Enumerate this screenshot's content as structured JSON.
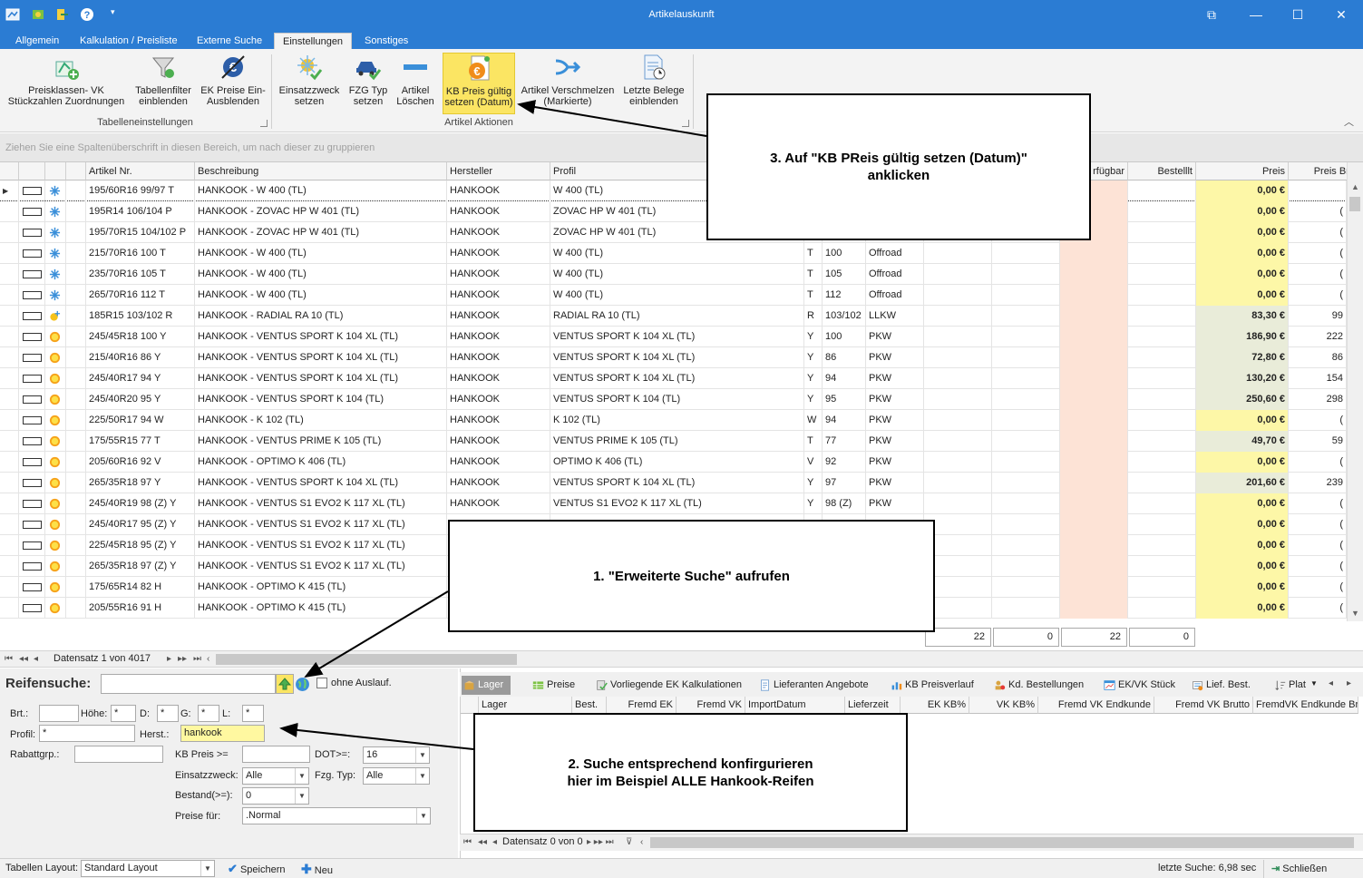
{
  "window": {
    "title": "Artikelauskunft"
  },
  "ribbon_tabs": [
    "Allgemein",
    "Kalkulation / Preisliste",
    "Externe Suche",
    "Einstellungen",
    "Sonstiges"
  ],
  "ribbon": {
    "buttons": [
      {
        "label": "Preisklassen- VK\nStückzahlen Zuordnungen",
        "icon": "price-class-icon"
      },
      {
        "label": "Tabellenfilter\neinblenden",
        "icon": "funnel-icon"
      },
      {
        "label": "EK Preise Ein-\nAusblenden",
        "icon": "euro-icon"
      },
      {
        "label": "Einsatzzweck\nsetzen",
        "icon": "purpose-icon"
      },
      {
        "label": "FZG Typ\nsetzen",
        "icon": "vehicle-icon"
      },
      {
        "label": "Artikel\nLöschen",
        "icon": "delete-icon"
      },
      {
        "label": "KB Preis gültig\nsetzen (Datum)",
        "icon": "euro-document-icon"
      },
      {
        "label": "Artikel Verschmelzen\n(Markierte)",
        "icon": "merge-icon"
      },
      {
        "label": "Letzte Belege\neinblenden",
        "icon": "document-clock-icon"
      }
    ],
    "groups": [
      "Tabelleneinstellungen",
      "Artikel Aktionen"
    ]
  },
  "group_bar": {
    "text": "Ziehen Sie eine Spaltenüberschrift in diesen Bereich, um nach dieser zu gruppieren"
  },
  "grid": {
    "columns": [
      "Artikel Nr.",
      "Beschreibung",
      "Hersteller",
      "Profil",
      "rfügbar",
      "Bestelllt",
      "Preis",
      "Preis Brut"
    ],
    "rows": [
      {
        "season": "winter",
        "artnr": "195/60R16 99/97 T",
        "desc": "HANKOOK - W 400 (TL)",
        "maker": "HANKOOK",
        "profil": "W 400 (TL)",
        "si": "",
        "li": "",
        "typ": "",
        "preis": "0,00 €",
        "brutto": ""
      },
      {
        "season": "winter",
        "artnr": "195R14 106/104 P",
        "desc": "HANKOOK - ZOVAC HP W 401 (TL)",
        "maker": "HANKOOK",
        "profil": "ZOVAC HP W 401 (TL)",
        "si": "",
        "li": "",
        "typ": "",
        "preis": "0,00 €",
        "brutto": "("
      },
      {
        "season": "winter",
        "artnr": "195/70R15 104/102 P",
        "desc": "HANKOOK - ZOVAC HP W 401 (TL)",
        "maker": "HANKOOK",
        "profil": "ZOVAC HP W 401 (TL)",
        "si": "",
        "li": "",
        "typ": "",
        "preis": "0,00 €",
        "brutto": "("
      },
      {
        "season": "winter",
        "artnr": "215/70R16 100 T",
        "desc": "HANKOOK - W 400 (TL)",
        "maker": "HANKOOK",
        "profil": "W 400 (TL)",
        "si": "T",
        "li": "100",
        "typ": "Offroad",
        "preis": "0,00 €",
        "brutto": "("
      },
      {
        "season": "winter",
        "artnr": "235/70R16 105 T",
        "desc": "HANKOOK - W 400 (TL)",
        "maker": "HANKOOK",
        "profil": "W 400 (TL)",
        "si": "T",
        "li": "105",
        "typ": "Offroad",
        "preis": "0,00 €",
        "brutto": "("
      },
      {
        "season": "winter",
        "artnr": "265/70R16 112 T",
        "desc": "HANKOOK - W 400 (TL)",
        "maker": "HANKOOK",
        "profil": "W 400 (TL)",
        "si": "T",
        "li": "112",
        "typ": "Offroad",
        "preis": "0,00 €",
        "brutto": "("
      },
      {
        "season": "allseason",
        "artnr": "185R15 103/102 R",
        "desc": "HANKOOK - RADIAL RA 10 (TL)",
        "maker": "HANKOOK",
        "profil": "RADIAL RA 10 (TL)",
        "si": "R",
        "li": "103/102",
        "typ": "LLKW",
        "preis": "83,30 €",
        "brutto": "99"
      },
      {
        "season": "summer",
        "artnr": "245/45R18 100 Y",
        "desc": "HANKOOK - VENTUS SPORT K 104 XL (TL)",
        "maker": "HANKOOK",
        "profil": "VENTUS SPORT K 104 XL (TL)",
        "si": "Y",
        "li": "100",
        "typ": "PKW",
        "preis": "186,90 €",
        "brutto": "222"
      },
      {
        "season": "summer",
        "artnr": "215/40R16 86 Y",
        "desc": "HANKOOK - VENTUS SPORT K 104 XL (TL)",
        "maker": "HANKOOK",
        "profil": "VENTUS SPORT K 104 XL (TL)",
        "si": "Y",
        "li": "86",
        "typ": "PKW",
        "preis": "72,80 €",
        "brutto": "86"
      },
      {
        "season": "summer",
        "artnr": "245/40R17 94 Y",
        "desc": "HANKOOK - VENTUS SPORT K 104 XL (TL)",
        "maker": "HANKOOK",
        "profil": "VENTUS SPORT K 104 XL (TL)",
        "si": "Y",
        "li": "94",
        "typ": "PKW",
        "preis": "130,20 €",
        "brutto": "154"
      },
      {
        "season": "summer",
        "artnr": "245/40R20 95 Y",
        "desc": "HANKOOK - VENTUS SPORT K 104 (TL)",
        "maker": "HANKOOK",
        "profil": "VENTUS SPORT K 104 (TL)",
        "si": "Y",
        "li": "95",
        "typ": "PKW",
        "preis": "250,60 €",
        "brutto": "298"
      },
      {
        "season": "summer",
        "artnr": "225/50R17 94 W",
        "desc": "HANKOOK - K 102 (TL)",
        "maker": "HANKOOK",
        "profil": "K 102 (TL)",
        "si": "W",
        "li": "94",
        "typ": "PKW",
        "preis": "0,00 €",
        "brutto": "("
      },
      {
        "season": "summer",
        "artnr": "175/55R15 77 T",
        "desc": "HANKOOK - VENTUS PRIME K 105 (TL)",
        "maker": "HANKOOK",
        "profil": "VENTUS PRIME K 105 (TL)",
        "si": "T",
        "li": "77",
        "typ": "PKW",
        "preis": "49,70 €",
        "brutto": "59"
      },
      {
        "season": "summer",
        "artnr": "205/60R16 92 V",
        "desc": "HANKOOK - OPTIMO K 406 (TL)",
        "maker": "HANKOOK",
        "profil": "OPTIMO K 406 (TL)",
        "si": "V",
        "li": "92",
        "typ": "PKW",
        "preis": "0,00 €",
        "brutto": "("
      },
      {
        "season": "summer",
        "artnr": "265/35R18 97 Y",
        "desc": "HANKOOK - VENTUS SPORT K 104 XL (TL)",
        "maker": "HANKOOK",
        "profil": "VENTUS SPORT K 104 XL (TL)",
        "si": "Y",
        "li": "97",
        "typ": "PKW",
        "preis": "201,60 €",
        "brutto": "239"
      },
      {
        "season": "summer",
        "artnr": "245/40R19 98 (Z) Y",
        "desc": "HANKOOK - VENTUS S1 EVO2 K 117 XL (TL)",
        "maker": "HANKOOK",
        "profil": "VENTUS S1 EVO2 K 117 XL (TL)",
        "si": "Y",
        "li": "98 (Z)",
        "typ": "PKW",
        "preis": "0,00 €",
        "brutto": "("
      },
      {
        "season": "summer",
        "artnr": "245/40R17 95 (Z) Y",
        "desc": "HANKOOK - VENTUS S1 EVO2 K 117 XL (TL)",
        "maker": "",
        "profil": "",
        "si": "",
        "li": "",
        "typ": "",
        "preis": "0,00 €",
        "brutto": "("
      },
      {
        "season": "summer",
        "artnr": "225/45R18 95 (Z) Y",
        "desc": "HANKOOK - VENTUS S1 EVO2 K 117 XL (TL)",
        "maker": "",
        "profil": "",
        "si": "",
        "li": "",
        "typ": "",
        "preis": "0,00 €",
        "brutto": "("
      },
      {
        "season": "summer",
        "artnr": "265/35R18 97 (Z) Y",
        "desc": "HANKOOK - VENTUS S1 EVO2 K 117 XL (TL)",
        "maker": "",
        "profil": "",
        "si": "",
        "li": "",
        "typ": "",
        "preis": "0,00 €",
        "brutto": "("
      },
      {
        "season": "summer",
        "artnr": "175/65R14 82 H",
        "desc": "HANKOOK - OPTIMO K 415 (TL)",
        "maker": "",
        "profil": "",
        "si": "",
        "li": "",
        "typ": "",
        "preis": "0,00 €",
        "brutto": "("
      },
      {
        "season": "summer",
        "artnr": "205/55R16 91 H",
        "desc": "HANKOOK - OPTIMO K 415 (TL)",
        "maker": "",
        "profil": "",
        "si": "",
        "li": "",
        "typ": "",
        "preis": "0,00 €",
        "brutto": "("
      }
    ],
    "sums": [
      "22",
      "0",
      "22",
      "0"
    ],
    "nav": "Datensatz 1 von 4017"
  },
  "search": {
    "title": "Reifensuche:",
    "ohne_auslauf": "ohne Auslauf.",
    "labels": {
      "brt": "Brt.:",
      "hoehe": "Höhe:",
      "d": "D:",
      "g": "G:",
      "l": "L:",
      "profil": "Profil:",
      "herst": "Herst.:",
      "rabatt": "Rabattgrp.:",
      "kbpreis": "KB Preis >=",
      "dot": "DOT>=:",
      "einsatz": "Einsatzzweck:",
      "fzg": "Fzg. Typ:",
      "bestand": "Bestand(>=):",
      "preise": "Preise für:"
    },
    "values": {
      "hoehe": "*",
      "d": "*",
      "g": "*",
      "l": "*",
      "profil": "*",
      "herst": "hankook",
      "dot": "16",
      "einsatz": "Alle",
      "fzg": "Alle",
      "bestand": "0",
      "preise": ".Normal"
    }
  },
  "bottom_tabs": [
    "Lager",
    "Preise",
    "Vorliegende EK Kalkulationen",
    "Lieferanten Angebote",
    "KB Preisverlauf",
    "Kd. Bestellungen",
    "EK/VK Stück",
    "Lief. Best.",
    "Plat"
  ],
  "sub_columns": [
    "Lager",
    "Best.",
    "Fremd EK",
    "Fremd VK",
    "ImportDatum",
    "Lieferzeit",
    "EK KB%",
    "VK KB%",
    "Fremd VK Endkunde",
    "Fremd VK Brutto",
    "FremdVK Endkunde Bru"
  ],
  "sub_nav": "Datensatz 0 von 0",
  "status": {
    "layout_label": "Tabellen Layout:",
    "layout_value": "Standard Layout",
    "save": "Speichern",
    "new": "Neu",
    "last_search": "letzte Suche: 6,98 sec",
    "close": "Schließen"
  },
  "callouts": {
    "c1": "1. \"Erweiterte Suche\" aufrufen",
    "c2": "2. Suche entsprechend konfirgurieren\nhier im Beispiel ALLE Hankook-Reifen",
    "c3": "3. Auf \"KB PReis gültig setzen (Datum)\"\nanklicken"
  }
}
